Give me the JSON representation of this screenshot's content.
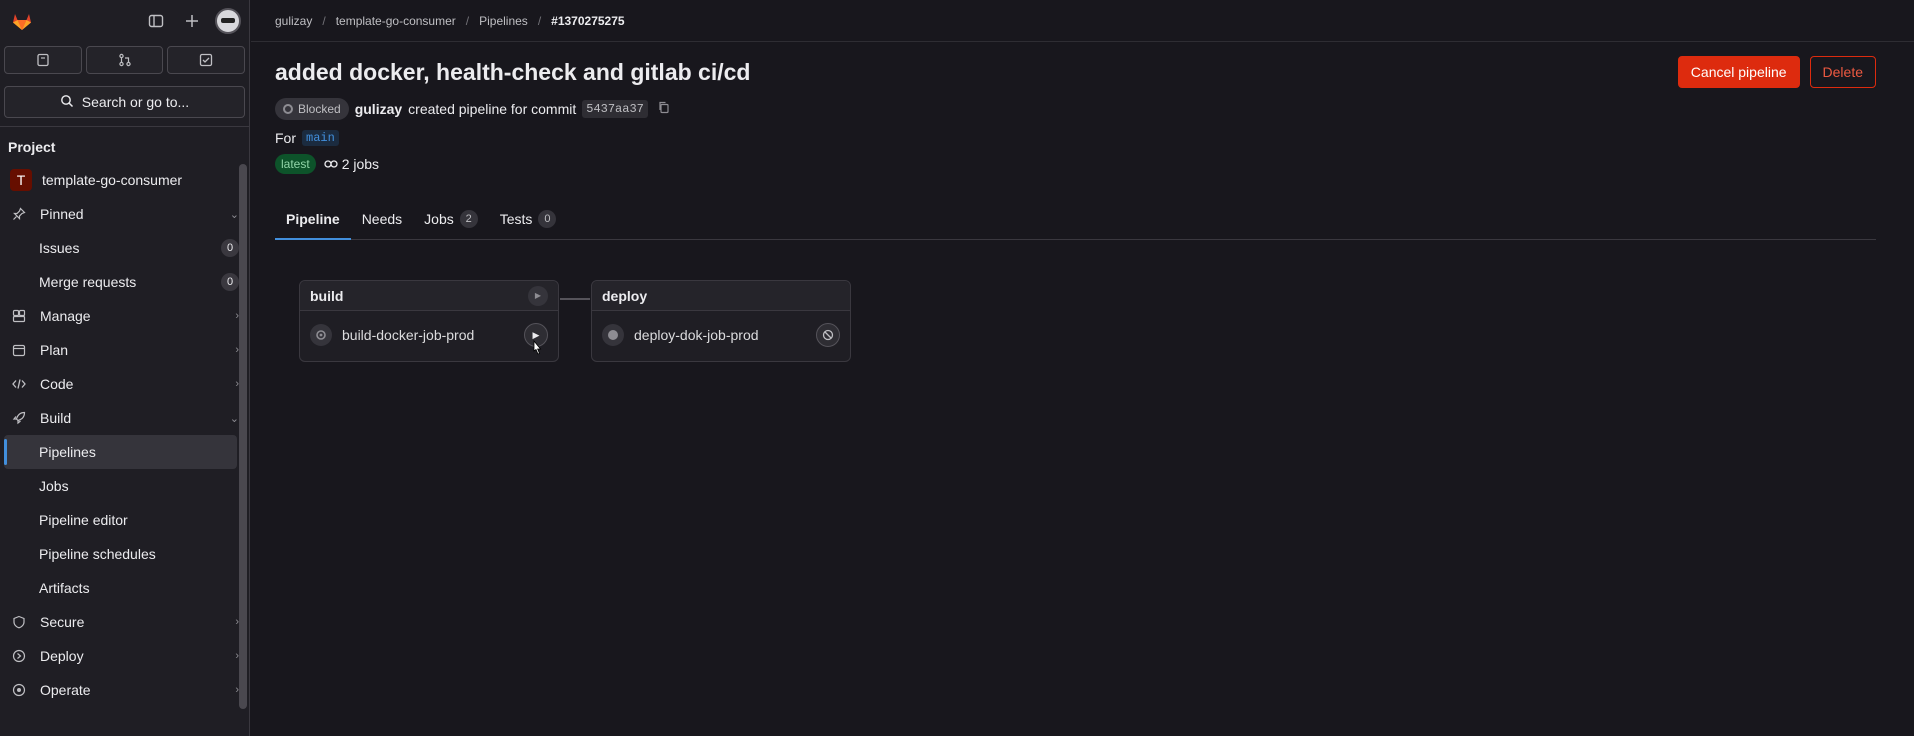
{
  "sidebar": {
    "search_label": "Search or go to...",
    "section_title": "Project",
    "project_name": "template-go-consumer",
    "project_initial": "T",
    "pinned": {
      "label": "Pinned"
    },
    "pinned_items": [
      {
        "label": "Issues",
        "count": "0"
      },
      {
        "label": "Merge requests",
        "count": "0"
      }
    ],
    "nav": {
      "manage": "Manage",
      "plan": "Plan",
      "code": "Code",
      "build": "Build",
      "secure": "Secure",
      "deploy": "Deploy",
      "operate": "Operate"
    },
    "build_items": {
      "pipelines": "Pipelines",
      "jobs": "Jobs",
      "pipeline_editor": "Pipeline editor",
      "pipeline_schedules": "Pipeline schedules",
      "artifacts": "Artifacts"
    }
  },
  "breadcrumb": {
    "user": "gulizay",
    "project": "template-go-consumer",
    "section": "Pipelines",
    "current": "#1370275275"
  },
  "pipeline": {
    "title": "added docker, health-check and gitlab ci/cd",
    "status": "Blocked",
    "author": "gulizay",
    "created_text": "created pipeline for commit",
    "commit_sha": "5437aa37",
    "for_label": "For",
    "branch": "main",
    "latest_label": "latest",
    "jobs_count": "2 jobs",
    "cancel_label": "Cancel pipeline",
    "delete_label": "Delete"
  },
  "tabs": [
    {
      "label": "Pipeline"
    },
    {
      "label": "Needs"
    },
    {
      "label": "Jobs",
      "count": "2"
    },
    {
      "label": "Tests",
      "count": "0"
    }
  ],
  "stages": [
    {
      "name": "build",
      "job": "build-docker-job-prod",
      "job_status": "manual"
    },
    {
      "name": "deploy",
      "job": "deploy-dok-job-prod",
      "job_status": "created"
    }
  ],
  "colors": {
    "accent": "#428fdc",
    "danger": "#dd2b0e",
    "latest_badge": "#0d532a"
  }
}
